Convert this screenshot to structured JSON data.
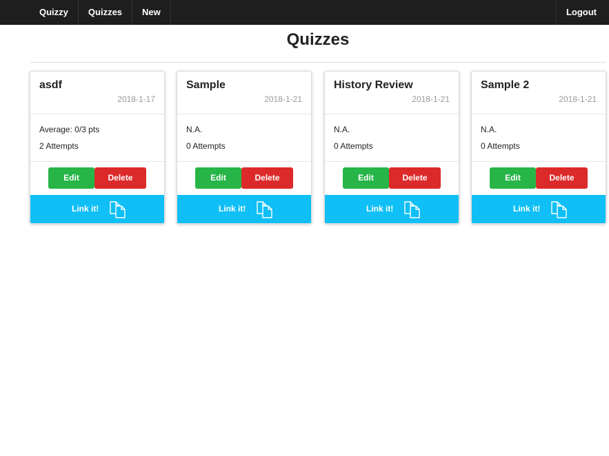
{
  "navbar": {
    "brand": "Quizzy",
    "links": [
      "Quizzes",
      "New"
    ],
    "logout": "Logout"
  },
  "page": {
    "title": "Quizzes"
  },
  "card_labels": {
    "edit": "Edit",
    "delete": "Delete",
    "link": "Link it!"
  },
  "quizzes": [
    {
      "title": "asdf",
      "date": "2018-1-17",
      "line1": "Average: 0/3 pts",
      "line2": "2 Attempts"
    },
    {
      "title": "Sample",
      "date": "2018-1-21",
      "line1": "N.A.",
      "line2": "0 Attempts"
    },
    {
      "title": "History Review",
      "date": "2018-1-21",
      "line1": "N.A.",
      "line2": "0 Attempts"
    },
    {
      "title": "Sample 2",
      "date": "2018-1-21",
      "line1": "N.A.",
      "line2": "0 Attempts"
    }
  ],
  "colors": {
    "navbar": "#1e1e1f",
    "edit": "#27b548",
    "delete": "#dc2a2a",
    "link_bar": "#0fbff5"
  },
  "icons": {
    "link": "copy-documents-icon"
  }
}
